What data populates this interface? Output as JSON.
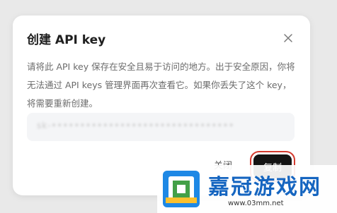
{
  "dialog": {
    "title": "创建 API key",
    "description": "请将此 API key 保存在安全且易于访问的地方。出于安全原因，你将无法通过 API keys 管理界面再次查看它。如果你丢失了这个 key，将需要重新创建。",
    "key_value": "sk-••••••••••••••••••••••••••••••••",
    "cancel_label": "关闭",
    "copy_label": "复制"
  },
  "watermark": {
    "name": "嘉冠游戏网",
    "url": "www.03mm.net"
  }
}
